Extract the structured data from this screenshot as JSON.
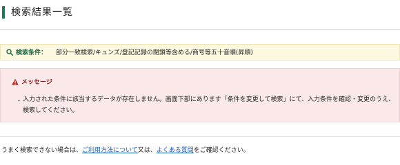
{
  "header": {
    "title": "検索結果一覧"
  },
  "search_conditions": {
    "icon": "search-icon",
    "label": "検索条件：",
    "value": "部分一致検索/キュンズ/登記記録の閉鎖等含める/商号等五十音順(昇順)"
  },
  "message": {
    "icon": "warning-icon",
    "title": "メッセージ",
    "bullet": "・",
    "text": "入力された条件に該当するデータが存在しません。画面下部にあります「条件を変更して検索」にて、入力条件を確認・変更のうえ、検索してください。"
  },
  "help": {
    "prefix": "うまく検索できない場合は、",
    "link1": "ご利用方法について",
    "middle": "又は、",
    "link2": "よくある質問",
    "suffix": "をご確認ください。"
  },
  "colors": {
    "accent": "#1f7a52",
    "link": "#1a5bb6",
    "condition_bg": "#fdf9e0",
    "message_bg": "#fbe9e9",
    "warning": "#b22222"
  }
}
